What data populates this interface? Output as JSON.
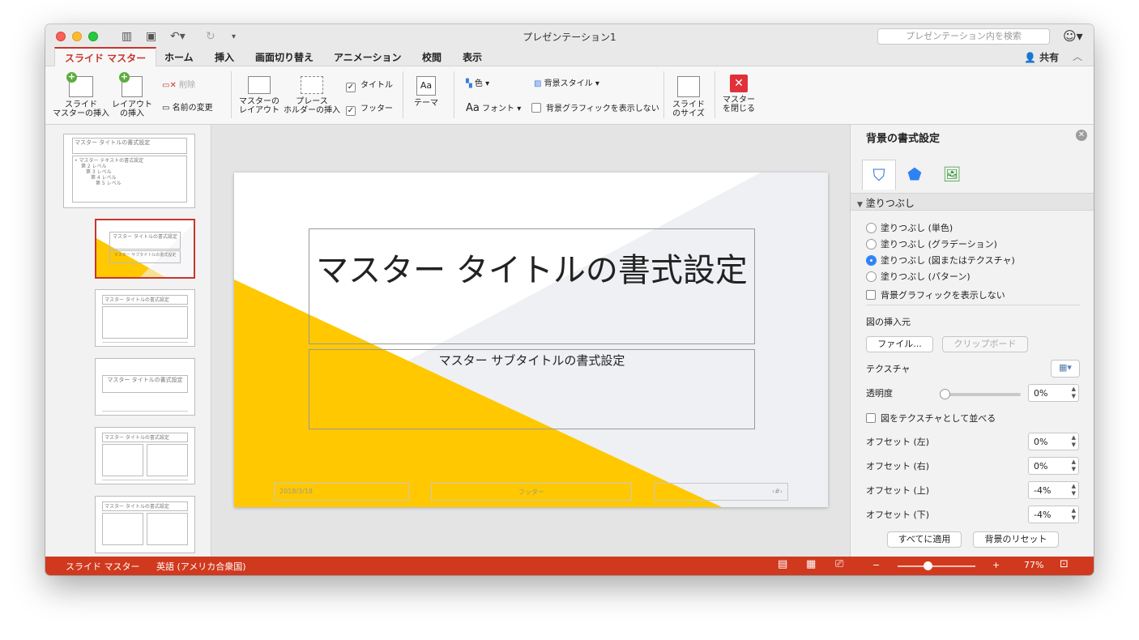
{
  "window": {
    "title": "プレゼンテーション1",
    "search_placeholder": "プレゼンテーション内を検索"
  },
  "tabs": [
    {
      "label": "スライド マスター",
      "active": true
    },
    {
      "label": "ホーム"
    },
    {
      "label": "挿入"
    },
    {
      "label": "画面切り替え"
    },
    {
      "label": "アニメーション"
    },
    {
      "label": "校閲"
    },
    {
      "label": "表示"
    }
  ],
  "share_label": "共有",
  "ribbon": {
    "insert_master": [
      "スライド",
      "マスターの挿入"
    ],
    "insert_layout": [
      "レイアウト",
      "の挿入"
    ],
    "delete": "削除",
    "rename": "名前の変更",
    "master_layout": [
      "マスターの",
      "レイアウト"
    ],
    "insert_placeholder": [
      "プレース",
      "ホルダーの挿入"
    ],
    "title_checkbox": "タイトル",
    "footer_checkbox": "フッター",
    "theme": "テーマ",
    "colors": "色",
    "fonts": "フォント",
    "background_styles": "背景スタイル",
    "hide_bg_graphics": "背景グラフィックを表示しない",
    "slide_size": [
      "スライド",
      "のサイズ"
    ],
    "close_master": [
      "マスター",
      "を閉じる"
    ]
  },
  "thumbnails": {
    "master_title": "マスター タイトルの書式設定",
    "master_text": "• マスター テキストの書式設定",
    "level2": "第 2 レベル",
    "level3": "第 3 レベル",
    "level4": "第 4 レベル",
    "level5": "第 5 レベル",
    "layout_title": "マスター タイトルの書式設定",
    "layout_subtitle": "マスター サブタイトルの書式設定",
    "thumb1_title": "マスター タイトルの書式設定",
    "thumb3_title": "マスター タイトルの書式設定",
    "thumb4_title": "マスター タイトルの書式設定",
    "thumb5_title": "マスター タイトルの書式設定",
    "thumb6_title": "マスター タイトルの書式設定"
  },
  "slide": {
    "title": "マスター タイトルの書式設定",
    "subtitle": "マスター サブタイトルの書式設定",
    "date": "2018/3/18",
    "footer": "フッター",
    "page_number": "‹#›",
    "accent_color": "#ffc800",
    "shade_color": "#eef0f3"
  },
  "panel": {
    "title": "背景の書式設定",
    "section": "塗りつぶし",
    "fill_options": [
      {
        "label": "塗りつぶし (単色)",
        "selected": false
      },
      {
        "label": "塗りつぶし (グラデーション)",
        "selected": false
      },
      {
        "label": "塗りつぶし (図またはテクスチャ)",
        "selected": true
      },
      {
        "label": "塗りつぶし (パターン)",
        "selected": false
      }
    ],
    "hide_bg_graphics": "背景グラフィックを表示しない",
    "insert_from": "図の挿入元",
    "file_button": "ファイル...",
    "clipboard_button": "クリップボード",
    "texture": "テクスチャ",
    "transparency": "透明度",
    "transparency_value": "0%",
    "tile_as_texture": "図をテクスチャとして並べる",
    "offsets": [
      {
        "label": "オフセット (左)",
        "value": "0%"
      },
      {
        "label": "オフセット (右)",
        "value": "0%"
      },
      {
        "label": "オフセット (上)",
        "value": "-4%"
      },
      {
        "label": "オフセット (下)",
        "value": "-4%"
      }
    ],
    "apply_all": "すべてに適用",
    "reset_bg": "背景のリセット"
  },
  "status": {
    "mode": "スライド マスター",
    "language": "英語 (アメリカ合衆国)",
    "zoom": "77%",
    "zoom_minus": "−",
    "zoom_plus": "+"
  },
  "colors": {
    "accent_red": "#c8352d",
    "status_bar": "#d0391e",
    "slide_yellow": "#ffc800"
  }
}
